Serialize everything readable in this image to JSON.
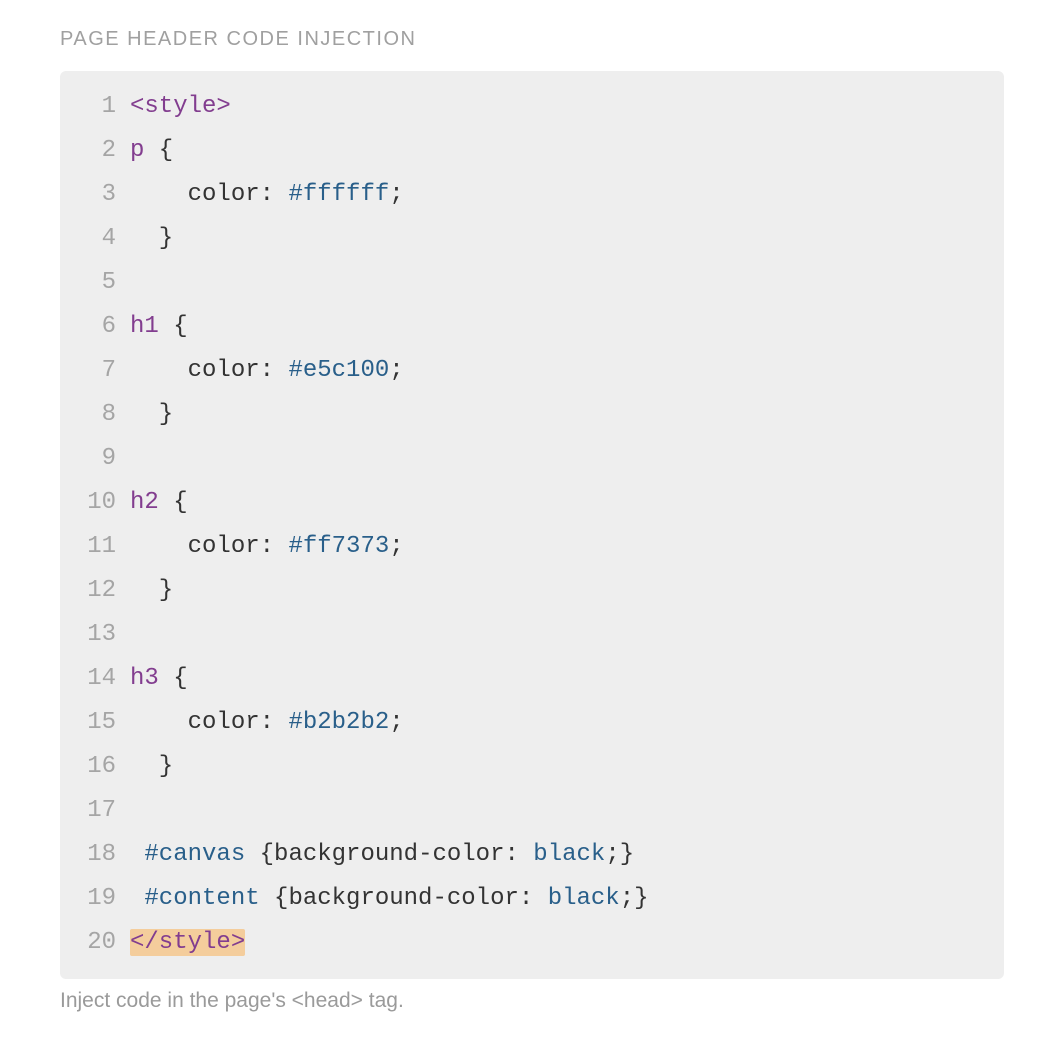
{
  "section_label": "PAGE HEADER CODE INJECTION",
  "help_text": "Inject code in the page's <head> tag.",
  "code": {
    "lines": [
      {
        "n": "1",
        "tokens": [
          {
            "t": "<style>",
            "c": "tok-tag"
          }
        ]
      },
      {
        "n": "2",
        "tokens": [
          {
            "t": "p",
            "c": "tok-sel"
          },
          {
            "t": " {",
            "c": "tok-plain"
          }
        ]
      },
      {
        "n": "3",
        "tokens": [
          {
            "t": "    ",
            "c": "tok-plain"
          },
          {
            "t": "color",
            "c": "tok-prop"
          },
          {
            "t": ": ",
            "c": "tok-plain"
          },
          {
            "t": "#ffffff",
            "c": "tok-val"
          },
          {
            "t": ";",
            "c": "tok-plain"
          }
        ]
      },
      {
        "n": "4",
        "tokens": [
          {
            "t": "  }",
            "c": "tok-plain"
          }
        ]
      },
      {
        "n": "5",
        "tokens": [
          {
            "t": "",
            "c": "tok-plain"
          }
        ]
      },
      {
        "n": "6",
        "tokens": [
          {
            "t": "h1",
            "c": "tok-sel"
          },
          {
            "t": " {",
            "c": "tok-plain"
          }
        ]
      },
      {
        "n": "7",
        "tokens": [
          {
            "t": "    ",
            "c": "tok-plain"
          },
          {
            "t": "color",
            "c": "tok-prop"
          },
          {
            "t": ": ",
            "c": "tok-plain"
          },
          {
            "t": "#e5c100",
            "c": "tok-val"
          },
          {
            "t": ";",
            "c": "tok-plain"
          }
        ]
      },
      {
        "n": "8",
        "tokens": [
          {
            "t": "  }",
            "c": "tok-plain"
          }
        ]
      },
      {
        "n": "9",
        "tokens": [
          {
            "t": "",
            "c": "tok-plain"
          }
        ]
      },
      {
        "n": "10",
        "tokens": [
          {
            "t": "h2",
            "c": "tok-sel"
          },
          {
            "t": " {",
            "c": "tok-plain"
          }
        ]
      },
      {
        "n": "11",
        "tokens": [
          {
            "t": "    ",
            "c": "tok-plain"
          },
          {
            "t": "color",
            "c": "tok-prop"
          },
          {
            "t": ": ",
            "c": "tok-plain"
          },
          {
            "t": "#ff7373",
            "c": "tok-val"
          },
          {
            "t": ";",
            "c": "tok-plain"
          }
        ]
      },
      {
        "n": "12",
        "tokens": [
          {
            "t": "  }",
            "c": "tok-plain"
          }
        ]
      },
      {
        "n": "13",
        "tokens": [
          {
            "t": "",
            "c": "tok-plain"
          }
        ]
      },
      {
        "n": "14",
        "tokens": [
          {
            "t": "h3",
            "c": "tok-sel"
          },
          {
            "t": " {",
            "c": "tok-plain"
          }
        ]
      },
      {
        "n": "15",
        "tokens": [
          {
            "t": "    ",
            "c": "tok-plain"
          },
          {
            "t": "color",
            "c": "tok-prop"
          },
          {
            "t": ": ",
            "c": "tok-plain"
          },
          {
            "t": "#b2b2b2",
            "c": "tok-val"
          },
          {
            "t": ";",
            "c": "tok-plain"
          }
        ]
      },
      {
        "n": "16",
        "tokens": [
          {
            "t": "  }",
            "c": "tok-plain"
          }
        ]
      },
      {
        "n": "17",
        "tokens": [
          {
            "t": "",
            "c": "tok-plain"
          }
        ]
      },
      {
        "n": "18",
        "tokens": [
          {
            "t": " ",
            "c": "tok-plain"
          },
          {
            "t": "#canvas",
            "c": "tok-val"
          },
          {
            "t": " {",
            "c": "tok-plain"
          },
          {
            "t": "background-color",
            "c": "tok-prop"
          },
          {
            "t": ": ",
            "c": "tok-plain"
          },
          {
            "t": "black",
            "c": "tok-val"
          },
          {
            "t": ";}",
            "c": "tok-plain"
          }
        ]
      },
      {
        "n": "19",
        "tokens": [
          {
            "t": " ",
            "c": "tok-plain"
          },
          {
            "t": "#content",
            "c": "tok-val"
          },
          {
            "t": " {",
            "c": "tok-plain"
          },
          {
            "t": "background-color",
            "c": "tok-prop"
          },
          {
            "t": ": ",
            "c": "tok-plain"
          },
          {
            "t": "black",
            "c": "tok-val"
          },
          {
            "t": ";}",
            "c": "tok-plain"
          }
        ]
      },
      {
        "n": "20",
        "tokens": [
          {
            "t": "</style>",
            "c": "tok-tag highlight-sel"
          }
        ]
      }
    ]
  }
}
